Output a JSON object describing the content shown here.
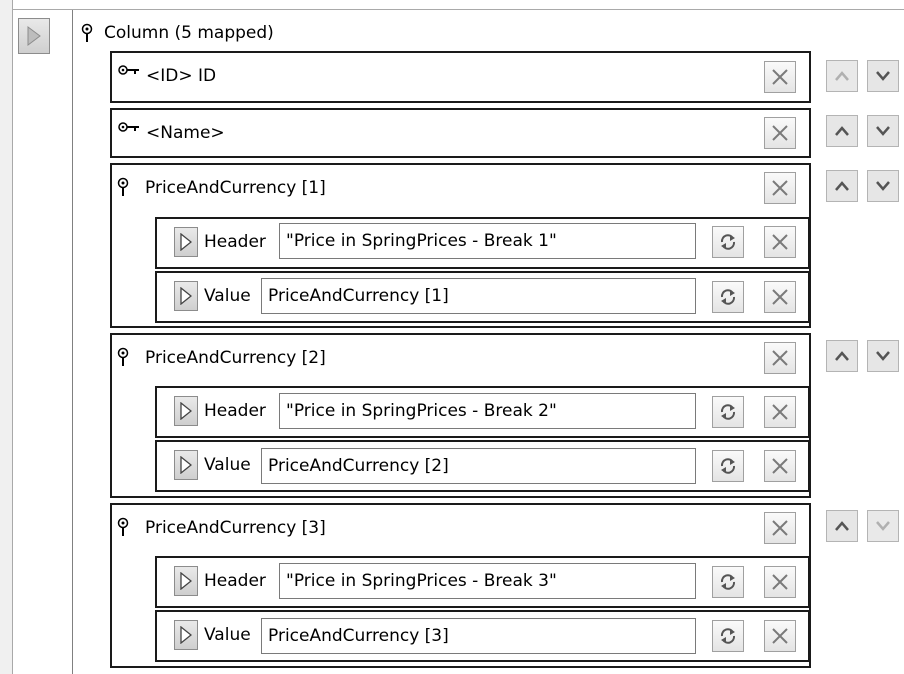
{
  "column": {
    "label": "Column (5 mapped)"
  },
  "mapped": [
    {
      "prefix": "<ID>",
      "name": "ID"
    },
    {
      "prefix": "<Name>",
      "name": ""
    }
  ],
  "groups": [
    {
      "title": "PriceAndCurrency [1]",
      "header_label": "Header",
      "header_value": "\"Price in SpringPrices - Break 1\"",
      "value_label": "Value",
      "value_value": "PriceAndCurrency [1]"
    },
    {
      "title": "PriceAndCurrency [2]",
      "header_label": "Header",
      "header_value": "\"Price in SpringPrices - Break 2\"",
      "value_label": "Value",
      "value_value": "PriceAndCurrency [2]"
    },
    {
      "title": "PriceAndCurrency [3]",
      "header_label": "Header",
      "header_value": "\"Price in SpringPrices - Break 3\"",
      "value_label": "Value",
      "value_value": "PriceAndCurrency [3]"
    }
  ],
  "icons": {
    "expand": "triangle-right-icon",
    "pin": "pin-icon",
    "key": "key-icon",
    "delete": "x-icon",
    "refresh": "refresh-icon",
    "up": "chevron-up-icon",
    "down": "chevron-down-icon"
  }
}
